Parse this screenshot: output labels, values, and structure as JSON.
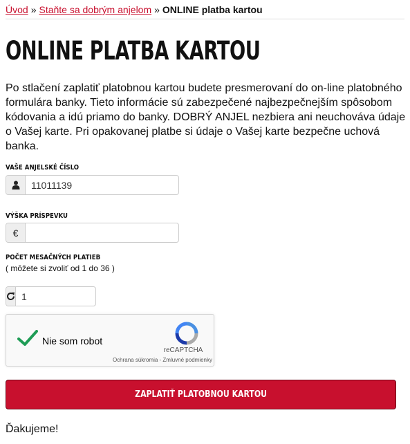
{
  "breadcrumb": {
    "items": [
      "Úvod",
      "Staňte sa dobrým anjelom"
    ],
    "separator": "»",
    "current": "ONLINE platba kartou"
  },
  "page_title": "ONLINE PLATBA KARTOU",
  "intro_text": "Po stlačení zaplatiť platobnou kartou budete presmerovaní do on-line platobného formulára banky. Tieto informácie sú zabezpečené najbezpečnejším spôsobom kódovania a idú priamo do banky. DOBRÝ ANJEL nezbiera ani neuchováva údaje o Vašej karte. Pri opakovanej platbe si údaje o Vašej karte bezpečne uchová banka.",
  "form": {
    "angel_number": {
      "label": "VAŠE ANJELSKÉ ČÍSLO",
      "value": "11011139",
      "icon": "user-icon"
    },
    "amount": {
      "label": "VÝŠKA PRÍSPEVKU",
      "value": "",
      "icon": "euro-icon",
      "icon_glyph": "€"
    },
    "payments": {
      "label": "POČET MESAČNÝCH PLATIEB",
      "hint": "( môžete si zvoliť od 1 do 36 )",
      "value": "1",
      "icon": "refresh-icon"
    }
  },
  "recaptcha": {
    "label": "Nie som robot",
    "brand": "reCAPTCHA",
    "terms": "Ochrana súkromia - Zmluvné podmienky",
    "checked": true,
    "check_color": "#1e9c55"
  },
  "submit_label": "ZAPLATIŤ PLATOBNOU KARTOU",
  "thanks_text": "Ďakujeme!",
  "colors": {
    "accent": "#c8102e"
  }
}
